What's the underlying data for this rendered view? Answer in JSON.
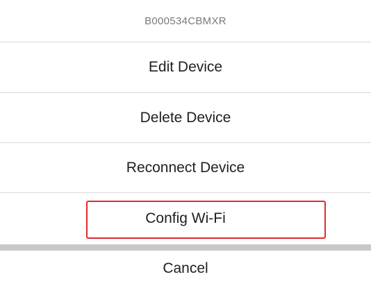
{
  "sheet": {
    "title": "B000534CBMXR",
    "actions": [
      {
        "label": "Edit Device"
      },
      {
        "label": "Delete Device"
      },
      {
        "label": "Reconnect Device"
      },
      {
        "label": "Config Wi-Fi",
        "highlighted": true
      }
    ],
    "cancel_label": "Cancel",
    "highlight_color": "#e02b2b",
    "separator_color": "#c8c8c8"
  }
}
